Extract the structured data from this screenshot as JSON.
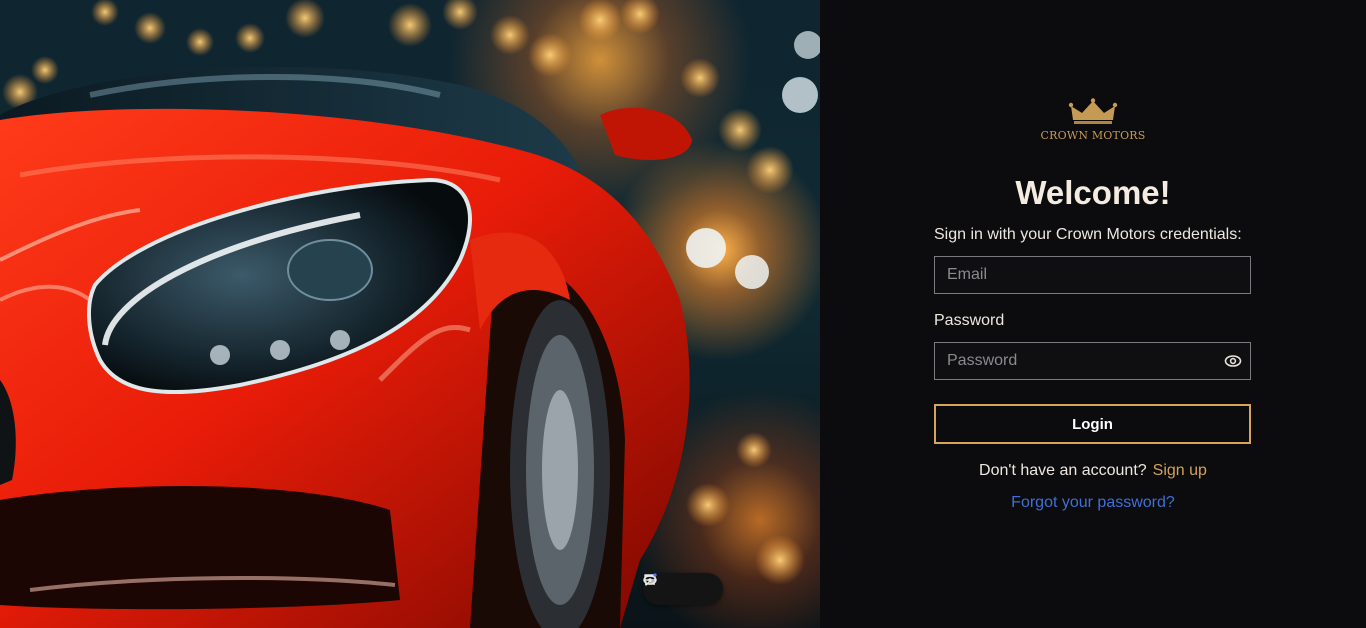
{
  "brand": {
    "name": "CROWN MOTORS",
    "logo_icon": "crown-icon",
    "accent_color": "#d6a45a"
  },
  "login": {
    "title": "Welcome!",
    "subtitle": "Sign in with your Crown Motors credentials:",
    "email": {
      "placeholder": "Email",
      "value": ""
    },
    "password": {
      "label": "Password",
      "placeholder": "Password",
      "value": "",
      "toggle_icon": "eye-icon"
    },
    "login_button": "Login",
    "signup_prompt": "Don't have an account?",
    "signup_link": "Sign up",
    "forgot_link": "Forgot your password?",
    "link_color": "#3f6fd6"
  },
  "hero": {
    "image": "red sports car headlight",
    "toolbar_icons": [
      "comment-icon",
      "eye-icon",
      "list-icon"
    ]
  }
}
